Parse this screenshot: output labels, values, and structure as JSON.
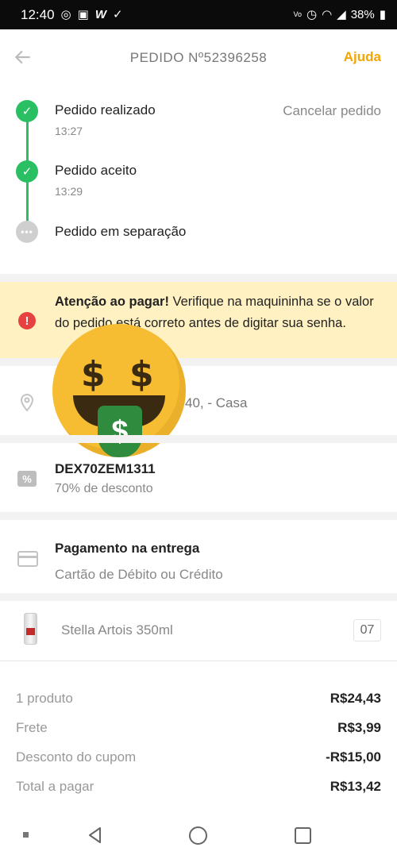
{
  "status_bar": {
    "time": "12:40",
    "battery": "38%",
    "icons": [
      "whatsapp-icon",
      "gallery-icon",
      "w-icon",
      "check-icon",
      "volte-icon",
      "alarm-icon",
      "wifi-icon",
      "signal-icon",
      "battery-icon"
    ]
  },
  "header": {
    "title": "PEDIDO Nº52396258",
    "help_label": "Ajuda"
  },
  "timeline": {
    "cancel_label": "Cancelar pedido",
    "steps": [
      {
        "label": "Pedido realizado",
        "time": "13:27",
        "status": "done"
      },
      {
        "label": "Pedido aceito",
        "time": "13:29",
        "status": "done"
      },
      {
        "label": "Pedido em separação",
        "time": "",
        "status": "pending"
      }
    ]
  },
  "alert": {
    "bold": "Atenção ao pagar!",
    "text": " Verifique na maquininha se o valor do pedido está correto antes de digitar sua senha."
  },
  "address": {
    "visible_text": "40,  - Casa"
  },
  "coupon": {
    "code": "DEX70ZEM1311",
    "description": "70% de desconto"
  },
  "payment": {
    "title": "Pagamento na entrega",
    "method": "Cartão de Débito ou Crédito"
  },
  "product": {
    "name": "Stella Artois 350ml",
    "quantity": "07"
  },
  "summary": [
    {
      "label": "1 produto",
      "value": "R$24,43"
    },
    {
      "label": "Frete",
      "value": "R$3,99"
    },
    {
      "label": "Desconto do cupom",
      "value": "-R$15,00"
    },
    {
      "label": "Total a pagar",
      "value": "R$13,42"
    }
  ],
  "colors": {
    "accent": "#f5a400",
    "success": "#2bbf63",
    "alert_bg": "#fff1c2",
    "alert_icon": "#e84141"
  }
}
